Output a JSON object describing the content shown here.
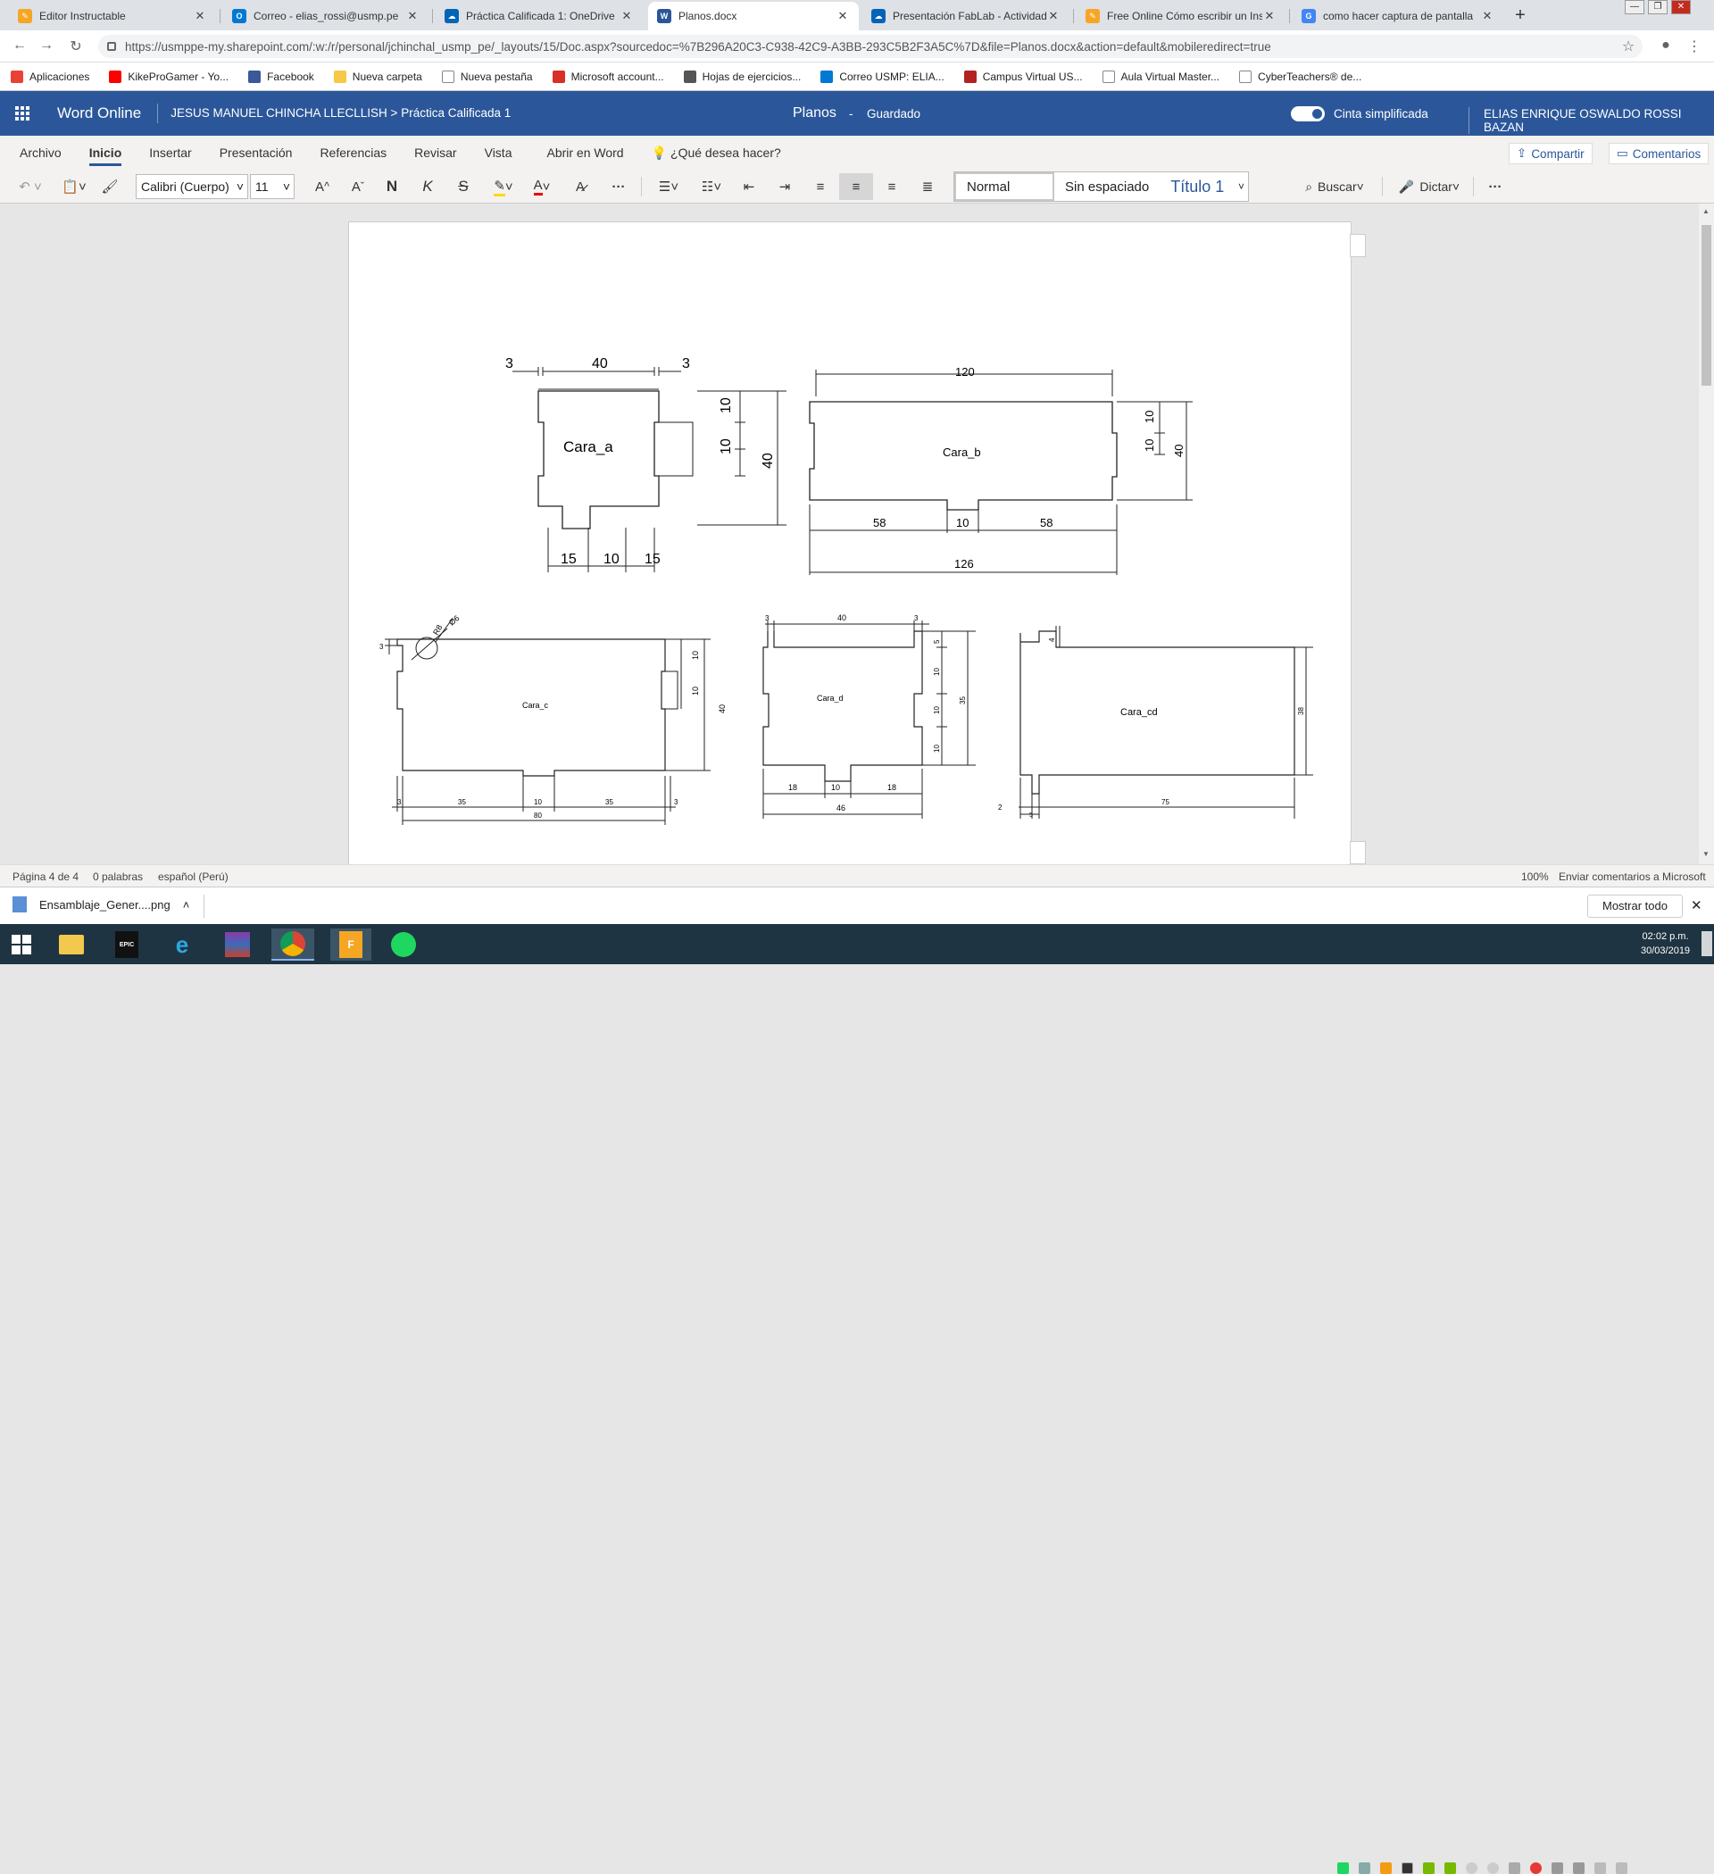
{
  "browser": {
    "tabs": [
      {
        "label": "Editor Instructable",
        "color": "#f5a623",
        "glyph": "✎"
      },
      {
        "label": "Correo - elias_rossi@usmp.pe",
        "color": "#0078d4",
        "glyph": "O"
      },
      {
        "label": "Práctica Calificada 1: OneDrive",
        "color": "#0364b8",
        "glyph": "☁"
      },
      {
        "label": "Planos.docx",
        "color": "#2b579a",
        "glyph": "W"
      },
      {
        "label": "Presentación FabLab - Actividad",
        "color": "#0364b8",
        "glyph": "☁"
      },
      {
        "label": "Free Online Cómo escribir un Ins",
        "color": "#f5a623",
        "glyph": "✎"
      },
      {
        "label": "como hacer captura de pantalla",
        "color": "#4285f4",
        "glyph": "G"
      }
    ],
    "url": "https://usmppe-my.sharepoint.com/:w:/r/personal/jchinchal_usmp_pe/_layouts/15/Doc.aspx?sourcedoc=%7B296A20C3-C938-42C9-A3BB-293C5B2F3A5C%7D&file=Planos.docx&action=default&mobileredirect=true",
    "bookmarks": [
      {
        "label": "Aplicaciones",
        "color": "#e94235"
      },
      {
        "label": "KikeProGamer - Yo...",
        "color": "#ff0000"
      },
      {
        "label": "Facebook",
        "color": "#3b5998"
      },
      {
        "label": "Nueva carpeta",
        "color": "#f7c948"
      },
      {
        "label": "Nueva pestaña",
        "color": "#888888"
      },
      {
        "label": "Microsoft account...",
        "color": "#d93025"
      },
      {
        "label": "Hojas de ejercicios...",
        "color": "#555555"
      },
      {
        "label": "Correo USMP: ELIA...",
        "color": "#0078d4"
      },
      {
        "label": "Campus Virtual US...",
        "color": "#b22222"
      },
      {
        "label": "Aula Virtual Master...",
        "color": "#888888"
      },
      {
        "label": "CyberTeachers® de...",
        "color": "#888888"
      }
    ]
  },
  "app": {
    "name": "Word Online",
    "breadcrumb_user": "JESUS MANUEL CHINCHA LLECLLISH",
    "breadcrumb_sep": ">",
    "breadcrumb_folder": "Práctica Calificada 1",
    "doc_title": "Planos",
    "dash": "-",
    "save_status": "Guardado",
    "simplified_ribbon": "Cinta simplificada",
    "user": "ELIAS ENRIQUE OSWALDO ROSSI BAZAN",
    "accent": "#2b579a"
  },
  "ribbon": {
    "tabs": [
      "Archivo",
      "Inicio",
      "Insertar",
      "Presentación",
      "Referencias",
      "Revisar",
      "Vista",
      "Abrir en Word"
    ],
    "tell_me": "¿Qué desea hacer?",
    "share": "Compartir",
    "comments": "Comentarios",
    "font": "Calibri (Cuerpo)",
    "size": "11",
    "bold": "N",
    "italic": "K",
    "strike": "S",
    "more": "···",
    "styles": [
      "Normal",
      "Sin espaciado",
      "Título 1"
    ],
    "find": "Buscar",
    "dictate": "Dictar"
  },
  "drawing": {
    "cara_a": {
      "label": "Cara_a",
      "top": [
        "3",
        "40",
        "3"
      ],
      "right": [
        "10",
        "10",
        "40"
      ],
      "bottom": [
        "15",
        "10",
        "15"
      ]
    },
    "cara_b": {
      "label": "Cara_b",
      "top": "120",
      "right": [
        "10",
        "10",
        "40"
      ],
      "bottom": [
        "58",
        "10",
        "58"
      ],
      "total": "126"
    },
    "cara_c": {
      "label": "Cara_c",
      "radius": "R8",
      "diameter": "Ø6",
      "left": "3",
      "right": [
        "10",
        "10",
        "40"
      ],
      "bottom": [
        "3",
        "35",
        "10",
        "35",
        "3"
      ],
      "total": "80"
    },
    "cara_d": {
      "label": "Cara_d",
      "top": [
        "3",
        "40",
        "3"
      ],
      "right": [
        "5",
        "10",
        "10",
        "10",
        "35"
      ],
      "bottom": [
        "18",
        "10",
        "18"
      ],
      "total": "46"
    },
    "cara_cd": {
      "label": "Cara_cd",
      "top": "4",
      "right": "38",
      "bottom": [
        "2",
        "5",
        "75"
      ]
    }
  },
  "status": {
    "page": "Página 4 de 4",
    "words": "0 palabras",
    "language": "español (Perú)",
    "zoom": "100%",
    "feedback": "Enviar comentarios a Microsoft"
  },
  "downloads": {
    "file": "Ensamblaje_Gener....png",
    "show_all": "Mostrar todo"
  },
  "taskbar": {
    "time": "02:02 p.m.",
    "date": "30/03/2019"
  }
}
